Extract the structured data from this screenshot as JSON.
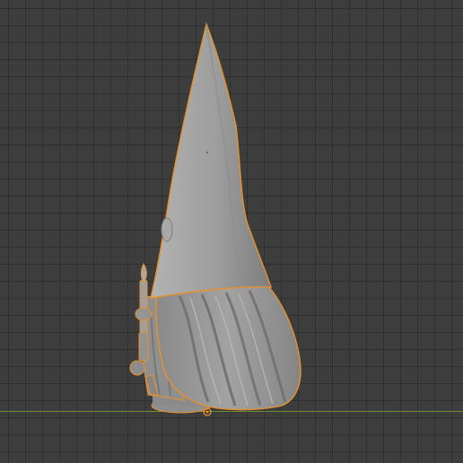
{
  "viewport": {
    "background_color": "#3d3d3d",
    "grid_color": "#333333",
    "x_axis_color": "#6f8a39",
    "selection_outline_color": "#e8912c",
    "object_color": "#9a9a9a"
  },
  "object": {
    "icon": "gnome-mesh-icon",
    "selected": true
  },
  "origin_marker": {
    "icon": "object-origin-icon"
  }
}
